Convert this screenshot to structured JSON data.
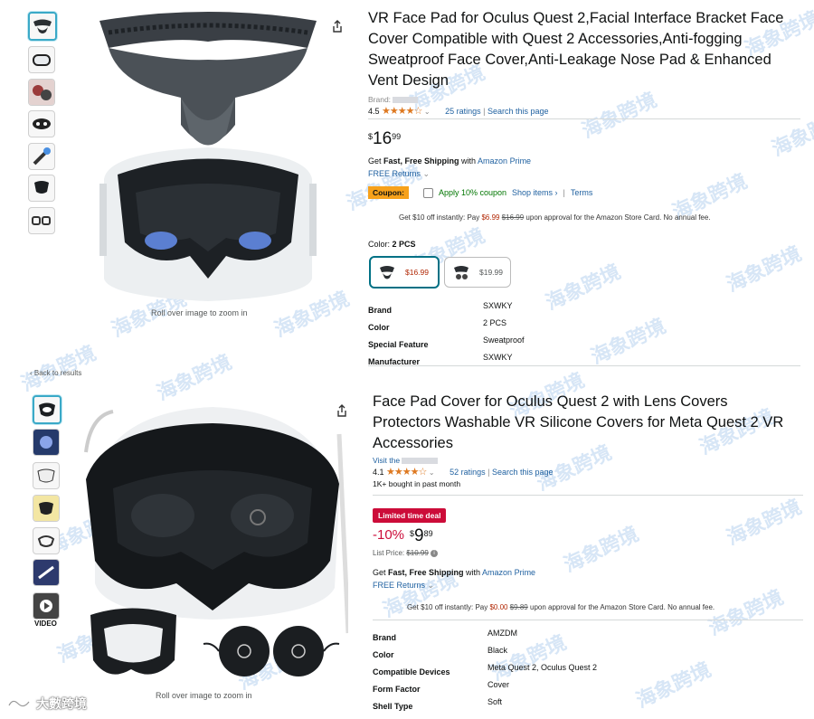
{
  "product1": {
    "title_lines": [
      "VR Face Pad for Oculus Quest 2,Facial Interface Bracket Face",
      "Cover Compatible with Quest 2 Accessories,Anti-fogging",
      "Sweatproof Face Cover,Anti-Leakage Nose Pad & Enhanced",
      "Vent Design"
    ],
    "brand_label": "Brand:",
    "rating": "4.5",
    "ratings_count": "25 ratings",
    "search_page": "Search this page",
    "price_symbol": "$",
    "price_whole": "16",
    "price_frac": "99",
    "shipping_prefix": "Get ",
    "shipping_bold": "Fast, Free Shipping",
    "shipping_with": " with ",
    "shipping_prime": "Amazon Prime",
    "free_returns": "FREE Returns",
    "coupon_badge": "Coupon:",
    "coupon_text": "Apply 10% coupon",
    "shop_items": "Shop items ›",
    "terms": "Terms",
    "promo_prefix": "Get $10 off instantly: Pay ",
    "promo_price": "$6.99",
    "promo_old": "$16.99",
    "promo_suffix": " upon approval for the Amazon Store Card. No annual fee.",
    "color_label": "Color: ",
    "color_value": "2 PCS",
    "swatch1_price": "$16.99",
    "swatch2_price": "$19.99",
    "zoom_hint": "Roll over image to zoom in",
    "attributes": [
      {
        "key": "Brand",
        "value": "SXWKY"
      },
      {
        "key": "Color",
        "value": "2 PCS"
      },
      {
        "key": "Special Feature",
        "value": "Sweatproof"
      },
      {
        "key": "Manufacturer",
        "value": "SXWKY"
      }
    ]
  },
  "back_link": "‹ Back to results",
  "product2": {
    "title_lines": [
      "Face Pad Cover for Oculus Quest 2 with Lens Covers",
      "Protectors Washable VR Silicone Covers for Meta Quest 2 VR",
      "Accessories"
    ],
    "visit_label": "Visit the",
    "rating": "4.1",
    "ratings_count": "52 ratings",
    "search_page": "Search this page",
    "bought": "1K+ bought in past month",
    "deal_badge": "Limited time deal",
    "discount": "-10%",
    "price_symbol": "$",
    "price_whole": "9",
    "price_frac": "89",
    "list_price_label": "List Price: ",
    "list_price": "$10.99",
    "shipping_prefix": "Get ",
    "shipping_bold": "Fast, Free Shipping",
    "shipping_with": " with ",
    "shipping_prime": "Amazon Prime",
    "free_returns": "FREE Returns",
    "promo_prefix": "Get $10 off instantly: Pay ",
    "promo_price": "$0.00",
    "promo_old": "$9.89",
    "promo_suffix": " upon approval for the Amazon Store Card. No annual fee.",
    "zoom_hint": "Roll over image to zoom in",
    "video_label": "VIDEO",
    "attributes": [
      {
        "key": "Brand",
        "value": "AMZDM"
      },
      {
        "key": "Color",
        "value": "Black"
      },
      {
        "key": "Compatible Devices",
        "value": "Meta Quest 2, Oculus Quest 2"
      },
      {
        "key": "Form Factor",
        "value": "Cover"
      },
      {
        "key": "Shell Type",
        "value": "Soft"
      }
    ]
  },
  "footer_logo_text": "大數跨境",
  "watermark_text": "海象跨境",
  "colors": {
    "accent_orange": "#de7921",
    "link_blue": "#2162a1",
    "deal_red": "#cc0c39",
    "coupon_orange": "#f7a11a",
    "promo_red": "#b12704"
  }
}
